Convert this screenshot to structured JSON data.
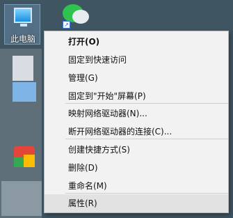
{
  "desktop": {
    "this_pc_label": "此电脑",
    "icons": [
      "computer-icon",
      "wechat-icon"
    ]
  },
  "context_menu": {
    "items": [
      {
        "label": "打开(O)",
        "bold": true
      },
      {
        "label": "固定到快速访问"
      },
      {
        "label": "管理(G)"
      },
      {
        "label": "固定到\"开始\"屏幕(P)"
      },
      {
        "label": "映射网络驱动器(N)..."
      },
      {
        "label": "断开网络驱动器的连接(C)..."
      },
      {
        "label": "创建快捷方式(S)"
      },
      {
        "label": "删除(D)"
      },
      {
        "label": "重命名(M)"
      },
      {
        "label": "属性(R)",
        "hovered": true
      }
    ]
  },
  "colors": {
    "menu_bg": "#f2f2f2",
    "hover_bg": "#e2e2e2",
    "wechat_green": "#2ec34e"
  }
}
